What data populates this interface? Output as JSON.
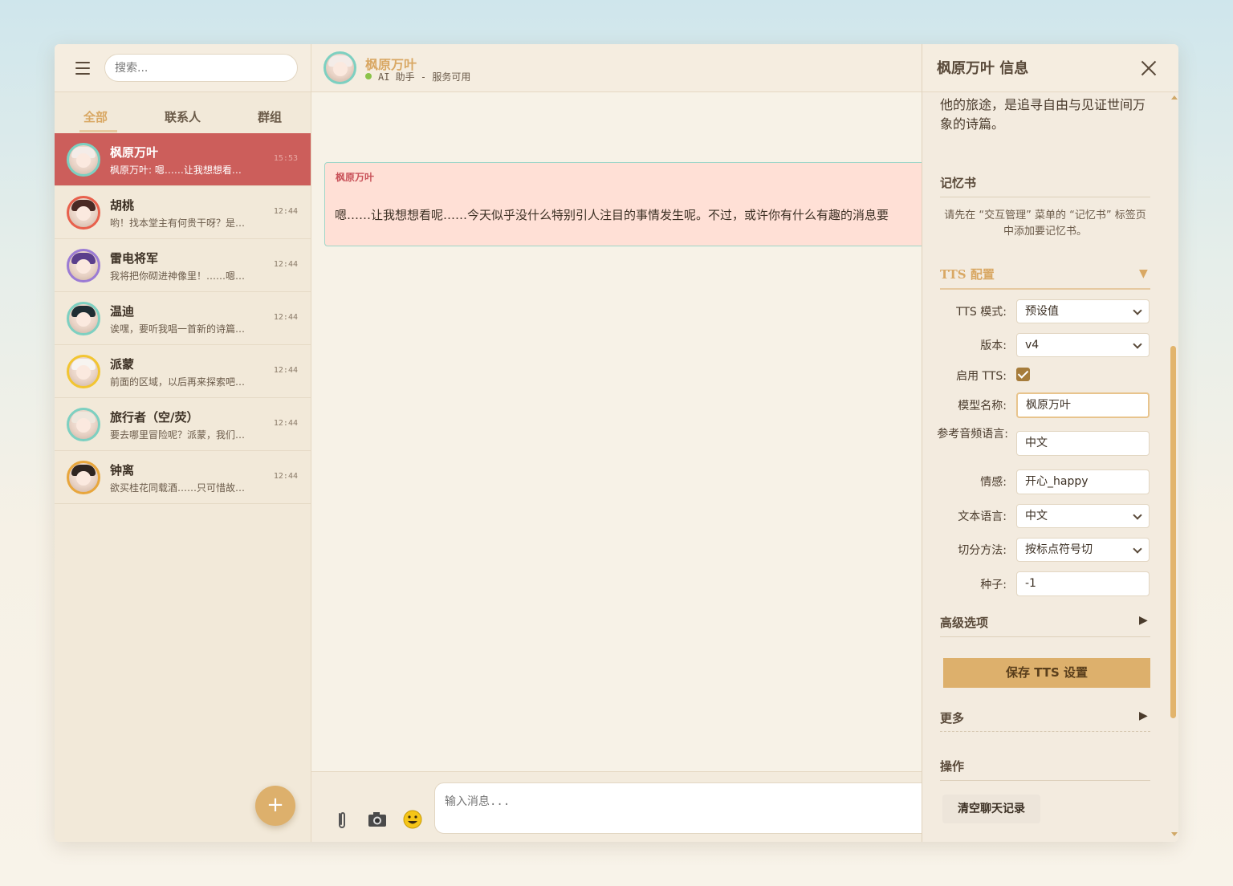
{
  "sidebar": {
    "search_placeholder": "搜索...",
    "tabs": [
      {
        "label": "全部",
        "active": true
      },
      {
        "label": "联系人",
        "active": false
      },
      {
        "label": "群组",
        "active": false
      }
    ],
    "contacts": [
      {
        "name": "枫原万叶",
        "preview": "枫原万叶: 嗯……让我想想看…",
        "time": "15:53",
        "active": true
      },
      {
        "name": "胡桃",
        "preview": "哟！找本堂主有何贵干呀？是…",
        "time": "12:44"
      },
      {
        "name": "雷电将军",
        "preview": "我将把你砌进神像里！……嗯…",
        "time": "12:44"
      },
      {
        "name": "温迪",
        "preview": "诶嘿，要听我唱一首新的诗篇…",
        "time": "12:44"
      },
      {
        "name": "派蒙",
        "preview": "前面的区域，以后再来探索吧…",
        "time": "12:44"
      },
      {
        "name": "旅行者（空/荧）",
        "preview": "要去哪里冒险呢？派蒙，我们…",
        "time": "12:44"
      },
      {
        "name": "钟离",
        "preview": "欲买桂花同载酒……只可惜故…",
        "time": "12:44"
      }
    ],
    "fab_label": "+"
  },
  "chat": {
    "name": "枫原万叶",
    "status": "AI 助手 - 服务可用",
    "messages": [
      {
        "sender": "枫原万叶",
        "text": "嗯……让我想想看呢……今天似乎没什么特别引人注目的事情发生呢。不过，或许你有什么有趣的消息要"
      }
    ],
    "input_placeholder": "输入消息..."
  },
  "panel": {
    "title": "枫原万叶 信息",
    "bio": "主的一刀”，替友人实现未了的心愿。他的旅途，是追寻自由与见证世间万象的诗篇。",
    "memory_title": "记忆书",
    "memory_note": "请先在 “交互管理” 菜单的 “记忆书” 标签页中添加要记忆书。",
    "tts_title": "TTS 配置",
    "tts_arrow": "▼",
    "fields": {
      "mode_label": "TTS 模式:",
      "mode_value": "预设值",
      "version_label": "版本:",
      "version_value": "v4",
      "enable_label": "启用 TTS:",
      "model_label": "模型名称:",
      "model_value": "枫原万叶",
      "ref_lang_label": "参考音频语言:",
      "ref_lang_value": "中文",
      "emotion_label": "情感:",
      "emotion_value": "开心_happy",
      "text_lang_label": "文本语言:",
      "text_lang_value": "中文",
      "split_label": "切分方法:",
      "split_value": "按标点符号切",
      "seed_label": "种子:",
      "seed_value": "-1"
    },
    "advanced_label": "高级选项",
    "save_label": "保存 TTS 设置",
    "more_label": "更多",
    "actions_title": "操作",
    "clear_label": "清空聊天记录",
    "expand_arrow": "▶"
  },
  "colors": {
    "accent": "#d9a864",
    "active_contact": "#cc5e5b",
    "bubble_bg": "#ffe0d6",
    "status_ok": "#8bc34a"
  },
  "icons": [
    "menu-icon",
    "paperclip-icon",
    "camera-icon",
    "emoji-icon",
    "close-icon",
    "checkbox-checked-icon",
    "chevron-down-icon",
    "triangle-right-icon"
  ]
}
